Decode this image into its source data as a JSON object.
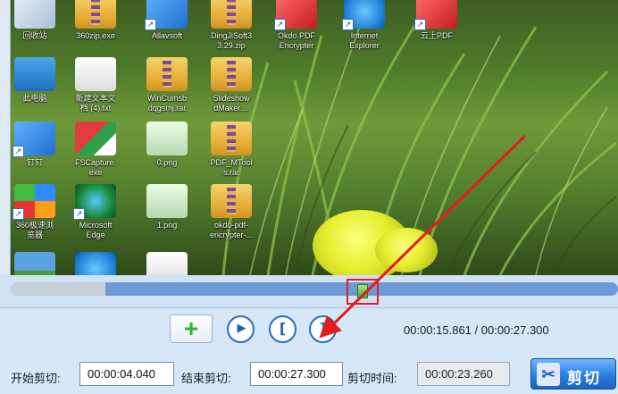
{
  "desktop_icons": [
    {
      "label": "回收站",
      "glyph": "g-recycle",
      "shortcut": false
    },
    {
      "label": "360zip.exe",
      "glyph": "g-folder",
      "shortcut": false
    },
    {
      "label": "Allavsoft",
      "glyph": "g-bird",
      "shortcut": true
    },
    {
      "label": "DingJiSoft3\n3.29.zip",
      "glyph": "g-folder",
      "shortcut": false
    },
    {
      "label": "Okdo PDF\nEncrypter",
      "glyph": "g-pdf",
      "shortcut": true
    },
    {
      "label": "Internet\nExplorer",
      "glyph": "g-ie",
      "shortcut": true
    },
    {
      "label": "云上PDF",
      "glyph": "g-pdf",
      "shortcut": true
    },
    {
      "label": "此电脑",
      "glyph": "g-pc",
      "shortcut": false
    },
    {
      "label": "新建文本文\n档 (4).txt",
      "glyph": "g-doc",
      "shortcut": false
    },
    {
      "label": "WinCumsb\ndqgsmj.rar",
      "glyph": "g-folder",
      "shortcut": false
    },
    {
      "label": "Slideshow\ndMaker....",
      "glyph": "g-folder",
      "shortcut": false
    },
    {
      "label": "钉钉",
      "glyph": "g-bird",
      "shortcut": true
    },
    {
      "label": "FSCapture.\nexe",
      "glyph": "g-fsc",
      "shortcut": false
    },
    {
      "label": "0.png",
      "glyph": "g-png",
      "shortcut": false
    },
    {
      "label": "PDF_MTool\ns.rar",
      "glyph": "g-folder",
      "shortcut": false
    },
    {
      "label": "360极速浏\n览器",
      "glyph": "g-speed",
      "shortcut": true
    },
    {
      "label": "Microsoft\nEdge",
      "glyph": "g-edge",
      "shortcut": true
    },
    {
      "label": "1.png",
      "glyph": "g-png",
      "shortcut": false
    },
    {
      "label": "okdo-pdf-\nencrypter-...",
      "glyph": "g-folder",
      "shortcut": false
    },
    {
      "label": "",
      "glyph": "g-land",
      "shortcut": false
    },
    {
      "label": "",
      "glyph": "g-ie",
      "shortcut": false
    },
    {
      "label": "",
      "glyph": "g-doc",
      "shortcut": false
    }
  ],
  "timeline": {
    "played_fraction": 0.156,
    "position_fraction": 0.58
  },
  "controls": {
    "add_symbol": "+",
    "play_symbol": "▶",
    "mark_start_symbol": "[",
    "mark_end_symbol": "]",
    "time_readout": "00:00:15.861 / 00:00:27.300"
  },
  "cut_settings": {
    "start_label": "开始剪切:",
    "start_value": "00:00:04.040",
    "end_label": "结束剪切:",
    "end_value": "00:00:27.300",
    "duration_label": "剪切时间:",
    "duration_value": "00:00:23.260"
  },
  "cut_button": {
    "label": "剪切",
    "icon": "scissors-icon"
  },
  "colors": {
    "annotation_red": "#e21d1d",
    "timeline_blue": "#6e98d6",
    "cut_button_blue": "#2a7fe0"
  }
}
